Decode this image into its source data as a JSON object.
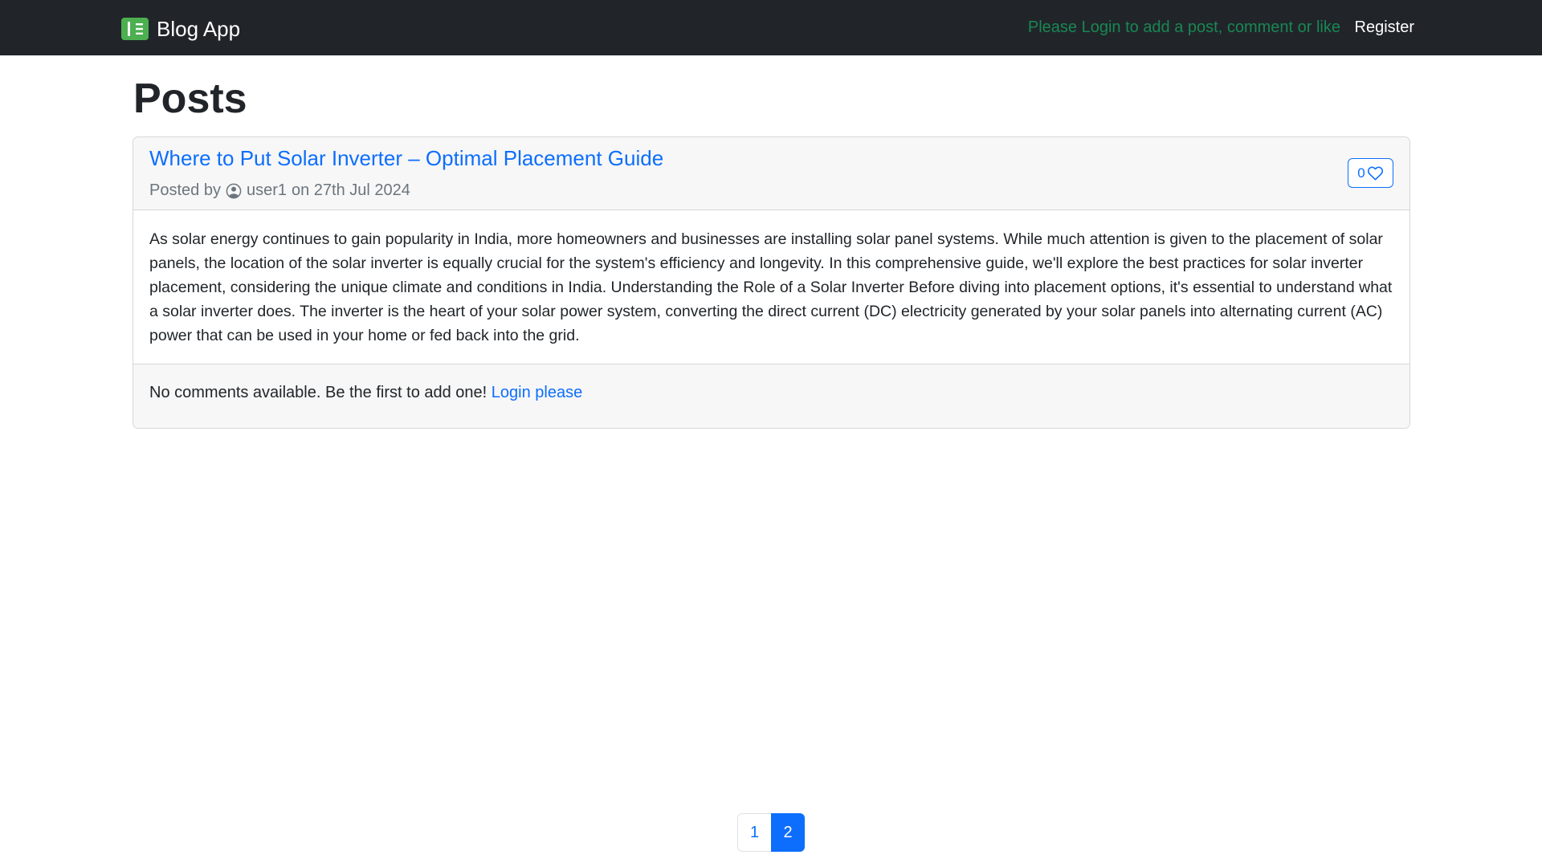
{
  "navbar": {
    "brand": "Blog App",
    "brand_icon": "journal-icon",
    "login_message": "Please Login to add a post, comment or like",
    "register_label": "Register"
  },
  "page": {
    "title": "Posts"
  },
  "post": {
    "title": "Where to Put Solar Inverter – Optimal Placement Guide",
    "posted_by_label": "Posted by",
    "author": "user1",
    "date_text": "on 27th Jul 2024",
    "like_count": "0",
    "body": "As solar energy continues to gain popularity in India, more homeowners and businesses are installing solar panel systems. While much attention is given to the placement of solar panels, the location of the solar inverter is equally crucial for the system's efficiency and longevity. In this comprehensive guide, we'll explore the best practices for solar inverter placement, considering the unique climate and conditions in India. Understanding the Role of a Solar Inverter Before diving into placement options, it's essential to understand what a solar inverter does. The inverter is the heart of your solar power system, converting the direct current (DC) electricity generated by your solar panels into alternating current (AC) power that can be used in your home or fed back into the grid.",
    "comments_text": "No comments available. Be the first to add one!",
    "login_link": "Login please"
  },
  "pagination": {
    "pages": [
      "1",
      "2"
    ],
    "active": "2"
  },
  "colors": {
    "navbar_bg": "#212529",
    "accent": "#0d6efd",
    "login_message": "#198754",
    "brand_icon": "#4caf50"
  }
}
